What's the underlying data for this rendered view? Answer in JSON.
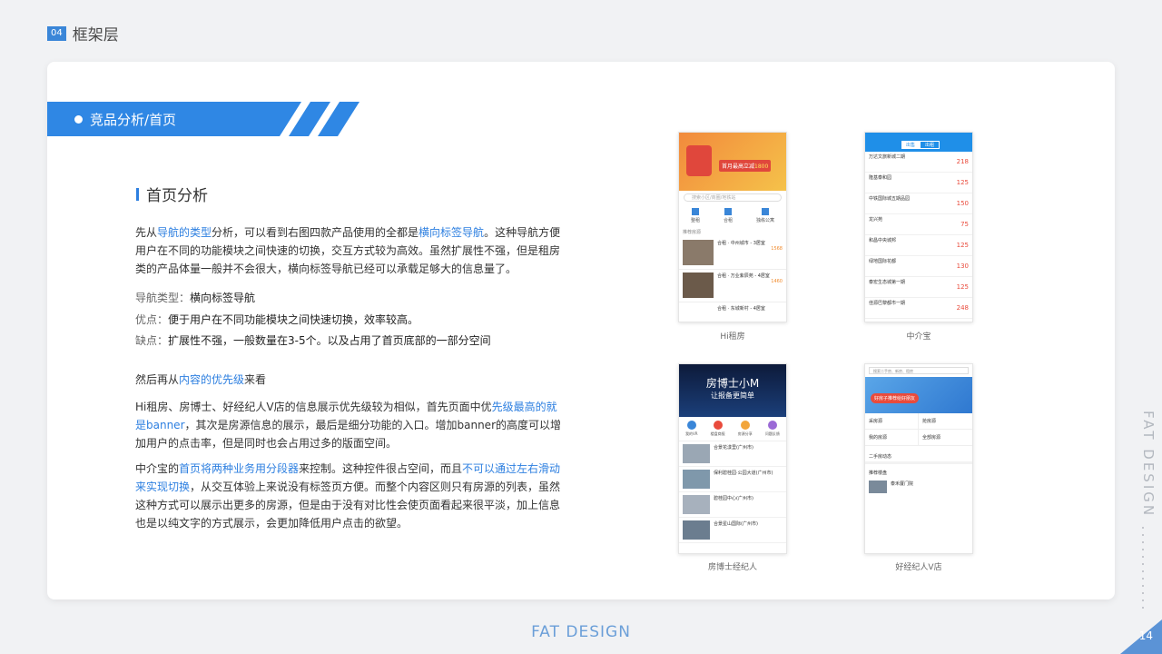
{
  "header": {
    "badge": "04",
    "title": "框架层"
  },
  "banner": {
    "title": "竞品分析/首页"
  },
  "section": {
    "title": "首页分析"
  },
  "para1": {
    "a": "先从",
    "b": "导航的类型",
    "c": "分析，可以看到右图四款产品使用的全都是",
    "d": "横向标签导航",
    "e": "。这种导航方便用户在不同的功能模块之间快速的切换，交互方式较为高效。虽然扩展性不强，但是租房类的产品体量一般并不会很大，横向标签导航已经可以承载足够大的信息量了。"
  },
  "nav_type": {
    "label": "导航类型：",
    "value": "横向标签导航"
  },
  "pros": {
    "label": "优点：",
    "value": "便于用户在不同功能模块之间快速切换，效率较高。"
  },
  "cons": {
    "label": "缺点：",
    "value": "扩展性不强，一般数量在3-5个。以及占用了首页底部的一部分空间"
  },
  "para2": {
    "a": "然后再从",
    "b": "内容的优先级",
    "c": "来看"
  },
  "para3": {
    "a": "Hi租房、房博士、好经纪人V店的信息展示优先级较为相似，首先页面中优",
    "b": "先级最高的就是banner",
    "c": "，其次是房源信息的展示，最后是细分功能的入口。增加banner的高度可以增加用户的点击率，但是同时也会占用过多的版面空间。"
  },
  "para4": {
    "a": "中介宝的",
    "b": "首页将两种业务用分段器",
    "c": "来控制。这种控件很占空间，而且",
    "d": "不可以通过左右滑动来实现切换",
    "e": "，从交互体验上来说没有标签页方便。而整个内容区则只有房源的列表，虽然这种方式可以展示出更多的房源，但是由于没有对比性会使页面看起来很平淡，加上信息也是以纯文字的方式展示，会更加降低用户点击的欲望。"
  },
  "phones": {
    "p1": {
      "caption": "Hi租房",
      "banner_text": "首月最高立减",
      "banner_amount": "1800",
      "search": "搜索小区/商圈/地铁站",
      "icons": [
        "整租",
        "合租",
        "独栋公寓"
      ],
      "list_header": "推荐房源",
      "items": [
        {
          "title": "合租 · 中州城市 - 3居室",
          "price": "1568"
        },
        {
          "title": "合租 · 万业紫辰苑 - 4居室",
          "price": "1460"
        },
        {
          "title": "合租 · 东城新村 - 4居室",
          "price": ""
        }
      ]
    },
    "p2": {
      "caption": "中介宝",
      "tabs": [
        "出售",
        "出租"
      ],
      "items": [
        {
          "title": "万达文旅新城二期",
          "price": "218"
        },
        {
          "title": "隆基泰和园",
          "price": "125"
        },
        {
          "title": "中铁国际城五期品园",
          "price": "150"
        },
        {
          "title": "龙兴苑",
          "price": "75"
        },
        {
          "title": "和昌中央城邦",
          "price": "125"
        },
        {
          "title": "绿地国际花都",
          "price": "130"
        },
        {
          "title": "泰宏生态城第一期",
          "price": "125"
        },
        {
          "title": "佳源巴黎都市一期",
          "price": "248"
        }
      ]
    },
    "p3": {
      "caption": "房博士经纪人",
      "banner_big": "房博士小M",
      "banner_sub": "让报备更简单",
      "icons": [
        "我的VR",
        "楼盘商报",
        "房源分享",
        "问题反馈"
      ],
      "items": [
        {
          "title": "合景花漾里(广州市)"
        },
        {
          "title": "保利碧桂园·公园大道(广州市)"
        },
        {
          "title": "碧桂园中心(广州市)"
        },
        {
          "title": "合景星山国际(广州市)"
        }
      ]
    },
    "p4": {
      "caption": "好经纪人V店",
      "search": "搜索二手房、新房、租房",
      "banner_text": "好房子推荐给好朋友",
      "tiles": [
        "采房源",
        "抢房源",
        "我的房源",
        "全部房源"
      ],
      "news": "二手房动态",
      "recommend": "推荐楼盘",
      "item": "泰禾厦门院"
    }
  },
  "side": {
    "brand": "FAT DESIGN"
  },
  "footer": {
    "brand": "FAT DESIGN",
    "page": "14"
  },
  "colors": {
    "accent": "#2d7fe0",
    "banner": "#2f87e4"
  }
}
